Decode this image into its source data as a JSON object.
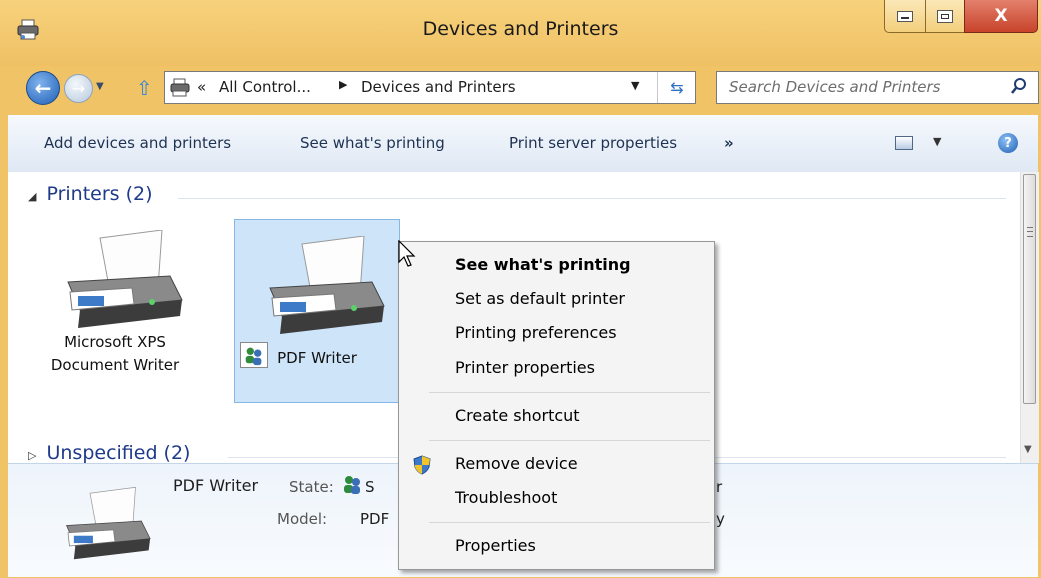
{
  "window": {
    "title": "Devices and Printers",
    "controls": {
      "minimize": "minimize",
      "maximize": "maximize",
      "close": "X"
    }
  },
  "nav": {
    "address": {
      "chevron": "«",
      "crumb1": "All Control...",
      "separator": "▶",
      "crumb2": "Devices and Printers"
    },
    "search_placeholder": "Search Devices and Printers"
  },
  "commands": {
    "add": "Add devices and printers",
    "see_printing": "See what's printing",
    "print_server": "Print server properties",
    "more": "»"
  },
  "groups": {
    "printers": {
      "label": "Printers (2)"
    },
    "unspecified": {
      "label": "Unspecified (2)"
    }
  },
  "devices": [
    {
      "label_line1": "Microsoft XPS",
      "label_line2": "Document Writer"
    },
    {
      "label": "PDF Writer",
      "selected": true
    }
  ],
  "details": {
    "name": "PDF Writer",
    "state_label": "State:",
    "state_value_visible": "S",
    "model_label": "Model:",
    "model_value_visible": "PDF",
    "tail1": "r",
    "tail2": "y"
  },
  "context_menu": {
    "items": [
      {
        "label": "See what's printing",
        "default": true
      },
      {
        "label": "Set as default printer"
      },
      {
        "label": "Printing preferences"
      },
      {
        "label": "Printer properties"
      },
      {
        "label": "Create shortcut"
      },
      {
        "label": "Remove device",
        "icon": "uac-shield-icon"
      },
      {
        "label": "Troubleshoot"
      },
      {
        "label": "Properties"
      }
    ]
  },
  "colors": {
    "titlebar": "#f0c466",
    "selection": "#cde4f9",
    "group_header": "#1e3a8a",
    "close_button": "#c8432b"
  }
}
